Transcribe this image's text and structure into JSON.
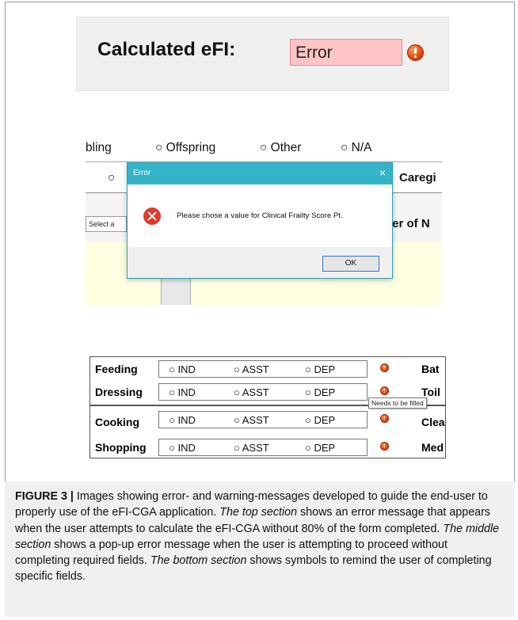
{
  "top_section": {
    "label": "Calculated eFI:",
    "value": "Error"
  },
  "middle_section": {
    "row1": {
      "cut_text": "bling",
      "options": [
        "Offspring",
        "Other",
        "N/A"
      ]
    },
    "row2": {
      "cut_text": "Caregi"
    },
    "select_placeholder": "Select a",
    "cut_label": "ber of N",
    "dialog": {
      "title": "Error",
      "close": "×",
      "message": "Please chose a value for Clinical Frailty Score Pt.",
      "ok_label": "OK"
    }
  },
  "bottom_section": {
    "rows": [
      {
        "label": "Feeding",
        "options": [
          "IND",
          "ASST",
          "DEP"
        ],
        "right": "Bat"
      },
      {
        "label": "Dressing",
        "options": [
          "IND",
          "ASST",
          "DEP"
        ],
        "right": "Toil"
      },
      {
        "label": "Cooking",
        "options": [
          "IND",
          "ASST",
          "DEP"
        ],
        "right": "Clea"
      },
      {
        "label": "Shopping",
        "options": [
          "IND",
          "ASST",
          "DEP"
        ],
        "right": "Med"
      }
    ],
    "tooltip": "Needs to be filled"
  },
  "caption": {
    "figure_label": "FIGURE 3 |",
    "text1": " Images showing error- and warning-messages developed to guide the end-user to properly use of the eFI-CGA application. ",
    "italic1": "The top section",
    "text2": " shows an error message that appears when the user attempts to calculate the eFI-CGA without 80% of the form completed. ",
    "italic2": "The middle section",
    "text3": " shows a pop-up error message when the user is attempting to proceed without completing required fields. ",
    "italic3": "The bottom section",
    "text4": " shows symbols to remind the user of completing specific fields."
  }
}
